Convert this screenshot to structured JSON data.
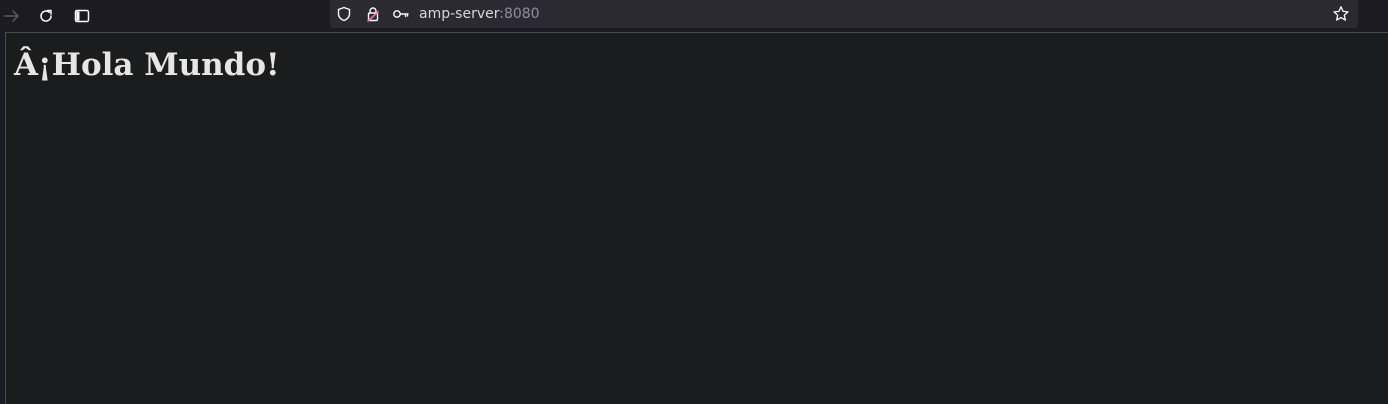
{
  "browser": {
    "url_host": "amp-server",
    "url_port": ":8080",
    "icons": {
      "forward": "forward-arrow-icon",
      "reload": "reload-icon",
      "sidebar": "sidebar-icon",
      "tracking_protection": "shield-icon",
      "security": "lock-warning-icon",
      "permissions": "key-icon",
      "bookmark": "star-icon"
    },
    "colors": {
      "toolbar_bg": "#1c1b22",
      "urlbar_bg": "#2b2a33",
      "icon": "#fbfbfe",
      "icon_disabled": "#5b5b66",
      "lock_warning": "#ff6b9b"
    }
  },
  "page": {
    "heading": "Â¡Hola Mundo!",
    "background": "#1b1c1e",
    "text_color": "#e8e6e3"
  }
}
